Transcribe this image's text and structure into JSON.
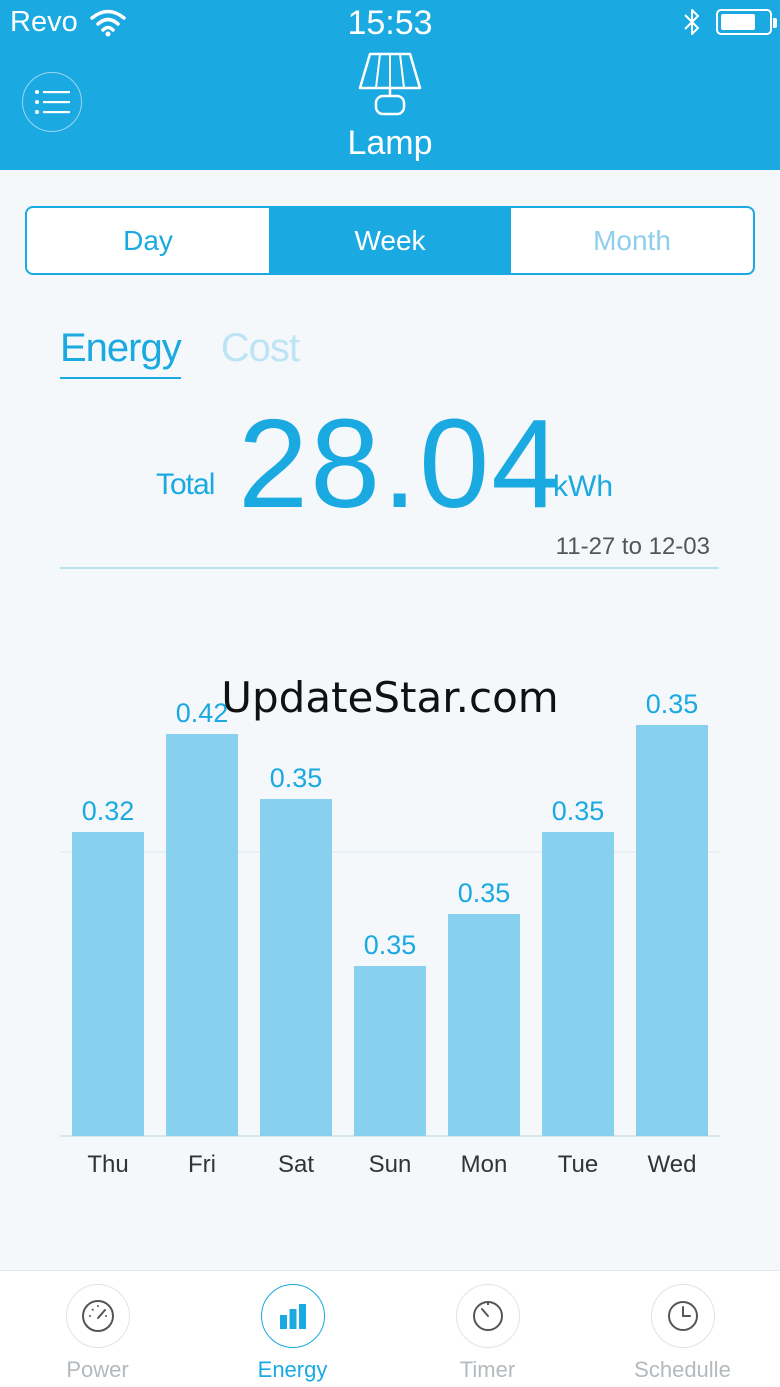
{
  "status": {
    "carrier": "Revo",
    "time": "15:53"
  },
  "header": {
    "device_name": "Lamp"
  },
  "period_tabs": {
    "items": [
      "Day",
      "Week",
      "Month"
    ],
    "active": "Week"
  },
  "metric_tabs": {
    "energy": "Energy",
    "cost": "Cost",
    "active": "Energy"
  },
  "summary": {
    "total_label": "Total",
    "total_value": "28.04",
    "unit": "kWh",
    "date_range": "11-27 to 12-03"
  },
  "watermark": "UpdateStar.com",
  "chart_data": {
    "type": "bar",
    "categories": [
      "Thu",
      "Fri",
      "Sat",
      "Sun",
      "Mon",
      "Tue",
      "Wed"
    ],
    "values": [
      0.32,
      0.42,
      0.35,
      0.35,
      0.35,
      0.35,
      0.35
    ],
    "labels": [
      "0.32",
      "0.42",
      "0.35",
      "0.35",
      "0.35",
      "0.35",
      "0.35"
    ],
    "bar_color": "#87d0ee",
    "label_color": "#1aa9e1",
    "grid": true
  },
  "bottom_nav": {
    "items": [
      {
        "label": "Power",
        "icon": "gauge-icon"
      },
      {
        "label": "Energy",
        "icon": "bar-chart-icon"
      },
      {
        "label": "Timer",
        "icon": "timer-icon"
      },
      {
        "label": "Schedulle",
        "icon": "clock-icon"
      }
    ],
    "active": "Energy"
  },
  "colors": {
    "accent": "#1aa9e1",
    "bar": "#87d0ee",
    "background": "#f4f8fb"
  }
}
